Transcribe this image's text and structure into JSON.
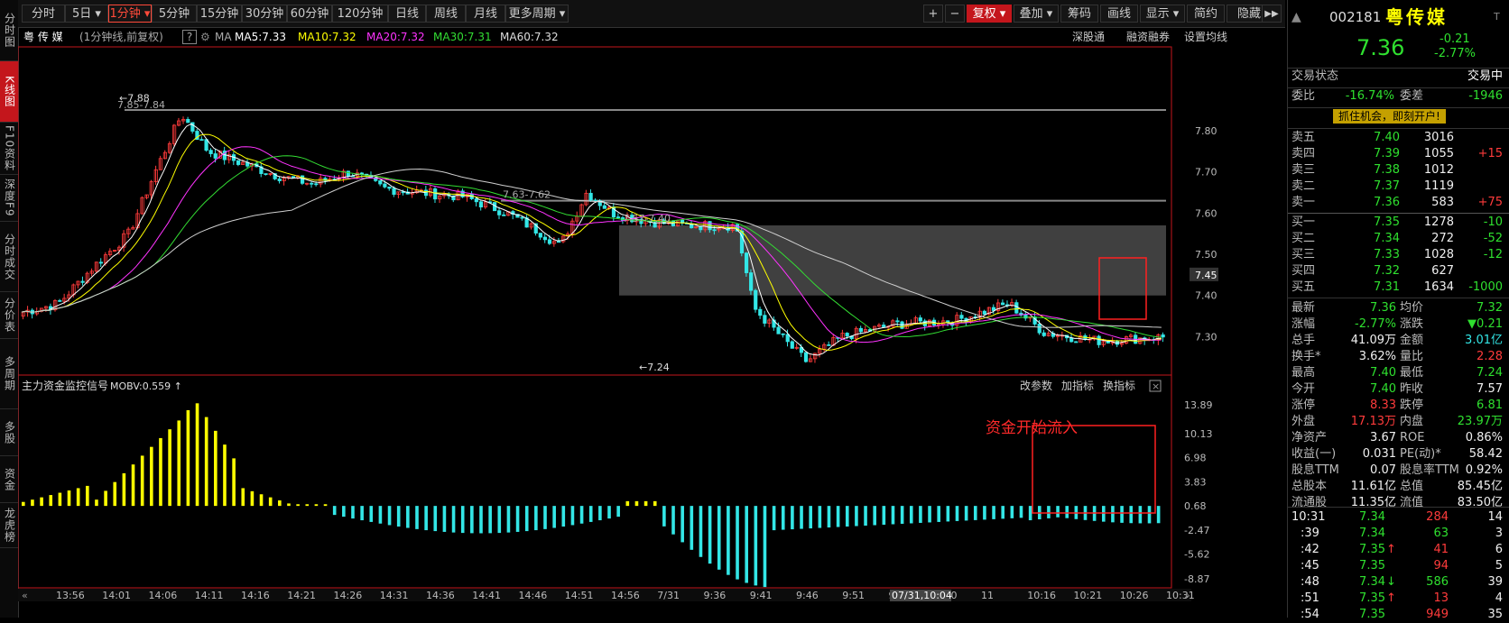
{
  "left_tabs": [
    {
      "label": "分时图",
      "active": false
    },
    {
      "label": "K线图",
      "active": true
    },
    {
      "label": "F10资料",
      "active": false
    },
    {
      "label": "深度F9",
      "active": false
    },
    {
      "label": "分时成交",
      "active": false
    },
    {
      "label": "分价表",
      "active": false
    },
    {
      "label": "多周期",
      "active": false
    },
    {
      "label": "多股",
      "active": false
    },
    {
      "label": "资金",
      "active": false
    },
    {
      "label": "龙虎榜",
      "active": false
    }
  ],
  "toolbar": {
    "periods": [
      "分时",
      "5日",
      "1分钟",
      "5分钟",
      "15分钟",
      "30分钟",
      "60分钟",
      "120分钟",
      "日线",
      "周线",
      "月线",
      "更多周期"
    ],
    "active_period": "1分钟",
    "right_buttons": [
      "+",
      "−",
      "复权",
      "叠加",
      "筹码",
      "画线",
      "显示",
      "简约",
      "隐藏"
    ],
    "collapse_glyph": "▶▶"
  },
  "infobar": {
    "stock_name": "粤 传 媒",
    "mode": "(1分钟线,前复权)",
    "help_glyph": "?",
    "ma_label": "MA",
    "ma5": "MA5:7.33",
    "ma10": "MA10:7.32",
    "ma20": "MA20:7.32",
    "ma30": "MA30:7.31",
    "ma60": "MA60:7.32",
    "links": [
      "深股通",
      "融资融券",
      "设置均线"
    ]
  },
  "main_axis": [
    "7.80",
    "7.70",
    "7.60",
    "7.50",
    "7.40",
    "7.30"
  ],
  "current_price_tag": "7.45",
  "annotations": {
    "high": "7.88",
    "high_range": "7.85-7.84",
    "mid_range": "7.63-7.62",
    "gap_range": "7.57-7.40",
    "low": "7.24"
  },
  "indicator": {
    "title": "主力资金监控信号",
    "mobv": "MOBV:0.559",
    "links": [
      "改参数",
      "加指标",
      "换指标"
    ],
    "axis": [
      "13.89",
      "10.13",
      "6.98",
      "3.83",
      "0.68",
      "-2.47",
      "-5.62",
      "-8.87"
    ],
    "note": "资金开始流入"
  },
  "time_axis": {
    "labels": [
      "13:56",
      "14:01",
      "14:06",
      "14:11",
      "14:16",
      "14:21",
      "14:26",
      "14:31",
      "14:36",
      "14:41",
      "14:46",
      "14:51",
      "14:56",
      "7/31",
      "9:36",
      "9:41",
      "9:46",
      "9:51",
      "9:56",
      "10:0",
      "11",
      "10:16",
      "10:21",
      "10:26",
      "10:31"
    ],
    "cursor": "07/31,10:04"
  },
  "quote": {
    "code": "002181",
    "name": "粤传媒",
    "price": "7.36",
    "change": "-0.21",
    "change_pct": "-2.77%",
    "trade_status_label": "交易状态",
    "trade_status": "交易中",
    "weibi_label": "委比",
    "weibi": "-16.74%",
    "weicha_label": "委差",
    "weicha": "-1946",
    "promo": "抓住机会，即刻开户!",
    "asks": [
      {
        "label": "卖五",
        "price": "7.40",
        "vol": "3016",
        "chg": ""
      },
      {
        "label": "卖四",
        "price": "7.39",
        "vol": "1055",
        "chg": "+15"
      },
      {
        "label": "卖三",
        "price": "7.38",
        "vol": "1012",
        "chg": ""
      },
      {
        "label": "卖二",
        "price": "7.37",
        "vol": "1119",
        "chg": ""
      },
      {
        "label": "卖一",
        "price": "7.36",
        "vol": "583",
        "chg": "+75"
      }
    ],
    "bids": [
      {
        "label": "买一",
        "price": "7.35",
        "vol": "1278",
        "chg": "-10"
      },
      {
        "label": "买二",
        "price": "7.34",
        "vol": "272",
        "chg": "-52"
      },
      {
        "label": "买三",
        "price": "7.33",
        "vol": "1028",
        "chg": "-12"
      },
      {
        "label": "买四",
        "price": "7.32",
        "vol": "627",
        "chg": ""
      },
      {
        "label": "买五",
        "price": "7.31",
        "vol": "1634",
        "chg": "-1000"
      }
    ],
    "stats": [
      {
        "l1": "最新",
        "v1": "7.36",
        "c1": "grn",
        "l2": "均价",
        "v2": "7.32",
        "c2": "grn"
      },
      {
        "l1": "涨幅",
        "v1": "-2.77%",
        "c1": "grn",
        "l2": "涨跌",
        "v2": "▼0.21",
        "c2": "grn"
      },
      {
        "l1": "总手",
        "v1": "41.09万",
        "c1": "wht",
        "l2": "金额",
        "v2": "3.01亿",
        "c2": "cya"
      },
      {
        "l1": "换手*",
        "v1": "3.62%",
        "c1": "wht",
        "l2": "量比",
        "v2": "2.28",
        "c2": "red"
      },
      {
        "l1": "最高",
        "v1": "7.40",
        "c1": "grn",
        "l2": "最低",
        "v2": "7.24",
        "c2": "grn"
      },
      {
        "l1": "今开",
        "v1": "7.40",
        "c1": "grn",
        "l2": "昨收",
        "v2": "7.57",
        "c2": "wht"
      },
      {
        "l1": "涨停",
        "v1": "8.33",
        "c1": "red",
        "l2": "跌停",
        "v2": "6.81",
        "c2": "grn"
      },
      {
        "l1": "外盘",
        "v1": "17.13万",
        "c1": "red",
        "l2": "内盘",
        "v2": "23.97万",
        "c2": "grn"
      },
      {
        "l1": "净资产",
        "v1": "3.67",
        "c1": "wht",
        "l2": "ROE",
        "v2": "0.86%",
        "c2": "wht"
      },
      {
        "l1": "收益(一)",
        "v1": "0.031",
        "c1": "wht",
        "l2": "PE(动)*",
        "v2": "58.42",
        "c2": "wht"
      },
      {
        "l1": "股息TTM",
        "v1": "0.07",
        "c1": "wht",
        "l2": "股息率TTM",
        "v2": "0.92%",
        "c2": "wht"
      },
      {
        "l1": "总股本",
        "v1": "11.61亿",
        "c1": "wht",
        "l2": "总值",
        "v2": "85.45亿",
        "c2": "wht"
      },
      {
        "l1": "流通股",
        "v1": "11.35亿",
        "c1": "wht",
        "l2": "流值",
        "v2": "83.50亿",
        "c2": "wht"
      }
    ],
    "ticks": [
      {
        "time": "10:31",
        "price": "7.34",
        "arrow": "",
        "vol": "284",
        "vc": "red",
        "n": "14"
      },
      {
        "time": ":39",
        "price": "7.34",
        "arrow": "",
        "vol": "63",
        "vc": "grn",
        "n": "3"
      },
      {
        "time": ":42",
        "price": "7.35",
        "arrow": "↑",
        "vol": "41",
        "vc": "red",
        "n": "6"
      },
      {
        "time": ":45",
        "price": "7.35",
        "arrow": "",
        "vol": "94",
        "vc": "red",
        "n": "5"
      },
      {
        "time": ":48",
        "price": "7.34",
        "arrow": "↓",
        "vol": "586",
        "vc": "grn",
        "n": "39"
      },
      {
        "time": ":51",
        "price": "7.35",
        "arrow": "↑",
        "vol": "13",
        "vc": "red",
        "n": "4"
      },
      {
        "time": ":54",
        "price": "7.35",
        "arrow": "",
        "vol": "949",
        "vc": "red",
        "n": "35"
      }
    ]
  },
  "colors": {
    "up": "#ff3b3b",
    "down": "#33e6e6",
    "ma5": "#ffffff",
    "ma10": "#ffff00",
    "ma20": "#ff33ff",
    "ma30": "#33dd33",
    "ma60": "#cfcfcf",
    "signal_pos": "#ffff00",
    "signal_neg": "#33e6e6",
    "accent": "#c4161c"
  }
}
